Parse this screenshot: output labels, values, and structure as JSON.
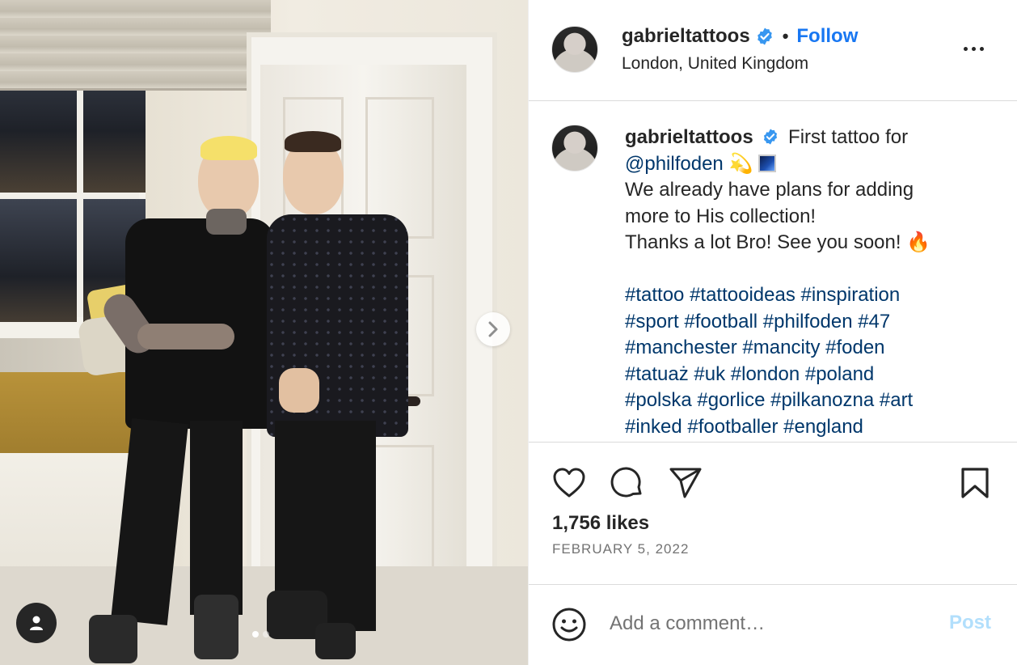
{
  "post": {
    "username": "gabrieltattoos",
    "location": "London, United Kingdom",
    "follow_label": "Follow",
    "separator": "•"
  },
  "caption": {
    "username": "gabrieltattoos",
    "text_1": "First tattoo for",
    "mention": "@philfoden",
    "emoji_1": "💫",
    "line_2": "We already have plans for adding",
    "line_3": "more to His collection!",
    "line_4": "Thanks a lot Bro! See you soon!",
    "emoji_fire": "🔥",
    "hashtag_lines": [
      "#tattoo #tattooideas #inspiration",
      "#sport #football #philfoden #47",
      "#manchester #mancity #foden",
      "#tatuaż #uk #london #poland",
      "#polska #gorlice #pilkanozna #art",
      "#inked #footballer #england"
    ]
  },
  "stats": {
    "likes": "1,756 likes",
    "date": "FEBRUARY 5, 2022"
  },
  "comment": {
    "placeholder": "Add a comment…",
    "post_label": "Post"
  },
  "carousel": {
    "current_index": 1,
    "total": 2
  },
  "colors": {
    "accent_blue": "#1877f2",
    "hashtag_blue": "#00376b",
    "post_disabled": "#b2dffc",
    "muted": "#737373",
    "border": "#dbdbdb"
  },
  "icons": [
    "verified-badge-icon",
    "more-options-icon",
    "heart-icon",
    "comment-icon",
    "share-icon",
    "bookmark-icon",
    "emoji-icon",
    "chevron-right-icon",
    "user-icon"
  ]
}
